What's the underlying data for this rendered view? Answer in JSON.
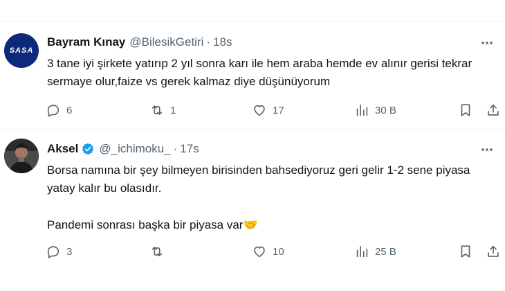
{
  "tweets": [
    {
      "avatar_text": "SASA",
      "name": "Bayram Kınay",
      "handle": "@BilesikGetiri",
      "separator": "·",
      "time": "18s",
      "text": "3 tane iyi şirkete yatırıp 2 yıl sonra karı ile hem araba hemde ev alınır gerisi tekrar sermaye olur,faize vs gerek kalmaz diye düşünüyorum",
      "replies": "6",
      "retweets": "1",
      "likes": "17",
      "views": "30 B"
    },
    {
      "name": "Aksel",
      "verified": true,
      "handle": "@_ichimoku_",
      "separator": "·",
      "time": "17s",
      "text_p1": "Borsa namına bir şey bilmeyen birisinden bahsediyoruz geri gelir 1-2 sene piyasa yatay kalır bu olasıdır.",
      "text_p2": "Pandemi sonrası başka bir piyasa var🤝",
      "replies": "3",
      "retweets": "",
      "likes": "10",
      "views": "25 B"
    }
  ],
  "colors": {
    "text": "#0f1419",
    "muted": "#536471",
    "divider": "#eff3f4",
    "verified": "#1d9bf0",
    "sasa_brand": "#0d2a7a"
  },
  "icons": [
    "more-icon",
    "reply-icon",
    "retweet-icon",
    "like-icon",
    "views-icon",
    "bookmark-icon",
    "share-icon",
    "verified-icon"
  ]
}
